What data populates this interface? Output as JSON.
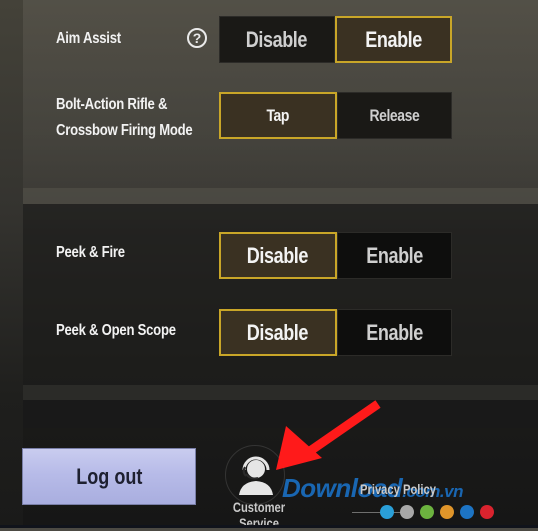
{
  "settings": {
    "rows": [
      {
        "label": "Aim Assist",
        "has_help": true,
        "options": [
          "Disable",
          "Enable"
        ],
        "selected": "Enable"
      },
      {
        "label_line1": "Bolt-Action Rifle &",
        "label_line2": "Crossbow Firing Mode",
        "options": [
          "Tap",
          "Release"
        ],
        "selected": "Tap"
      },
      {
        "label": "Peek & Fire",
        "options": [
          "Disable",
          "Enable"
        ],
        "selected": "Disable"
      },
      {
        "label": "Peek & Open Scope",
        "options": [
          "Disable",
          "Enable"
        ],
        "selected": "Disable"
      }
    ],
    "help_glyph": "?"
  },
  "footer": {
    "logout_label": "Log out",
    "customer_service_label": "Customer Service",
    "customer_service_icon": "headset-agent-icon",
    "privacy_label": "Privacy Policy"
  },
  "annotation": {
    "arrow_color": "#ff1a1a"
  },
  "watermark": {
    "text": "Download",
    "suffix": ".com.vn",
    "dot_colors": [
      "#2a9fd8",
      "#a8a8a8",
      "#6cb33f",
      "#e0952a",
      "#1d74c4",
      "#d9232e"
    ]
  },
  "colors": {
    "selected_border": "#c9a628",
    "selected_fill": "#3a3122",
    "logout_fill": "#b7bbe8"
  }
}
